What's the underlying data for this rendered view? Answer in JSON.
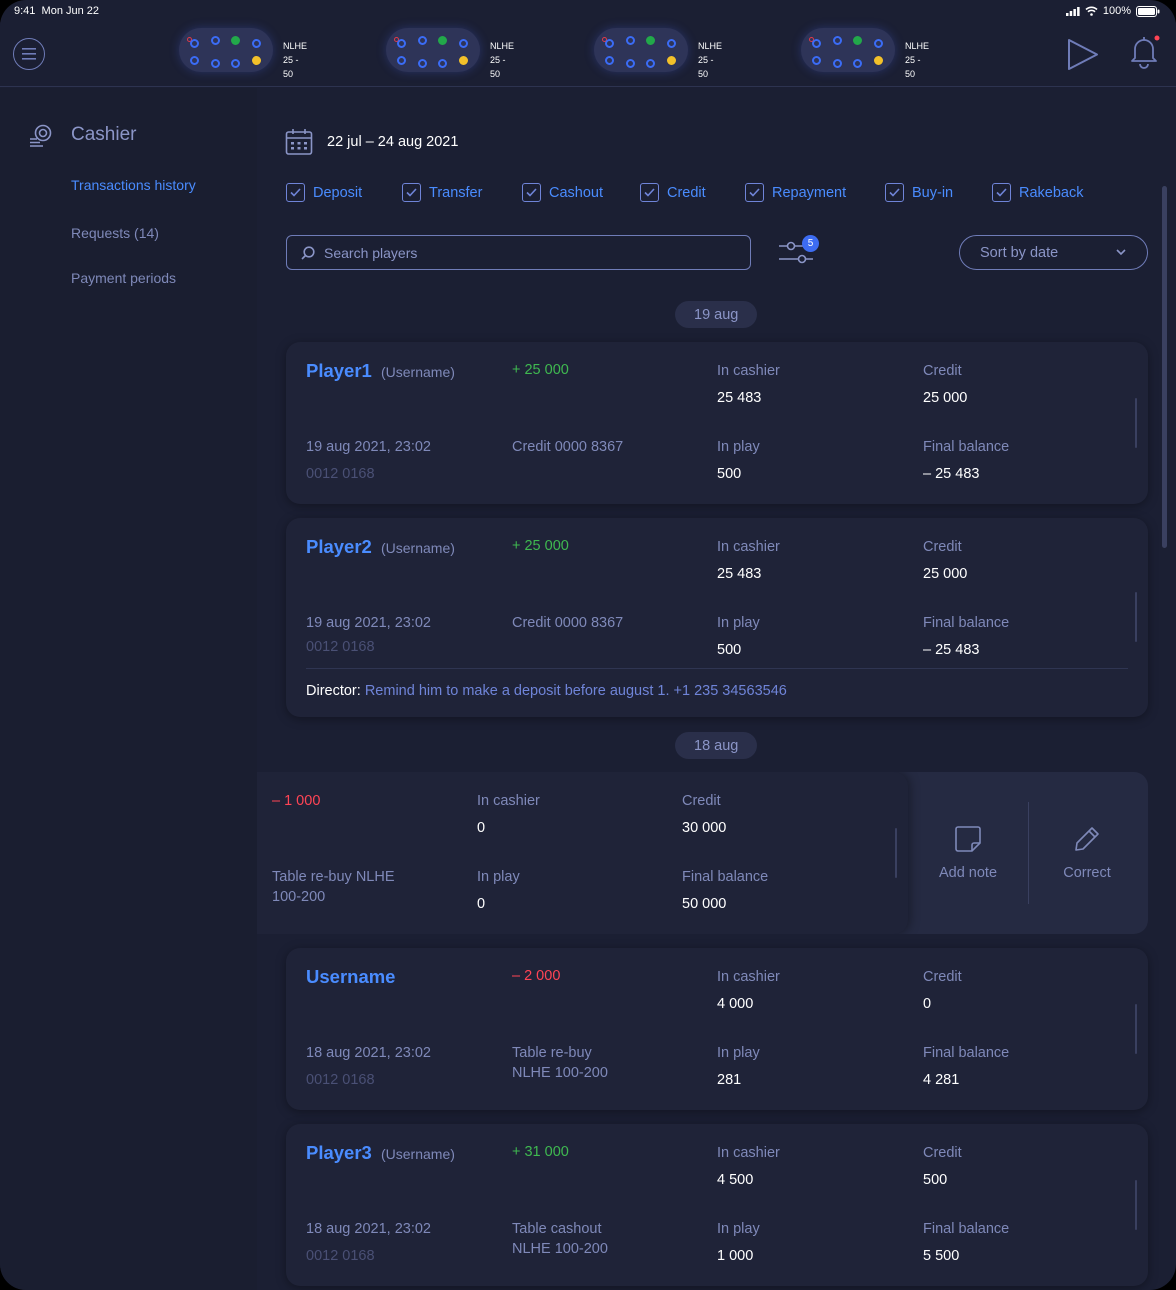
{
  "status": {
    "time": "9:41",
    "date": "Mon Jun 22",
    "battery": "100%"
  },
  "tables": [
    {
      "game": "NLHE",
      "stakes": "25 - 50"
    },
    {
      "game": "NLHE",
      "stakes": "25 - 50"
    },
    {
      "game": "NLHE",
      "stakes": "25 - 50"
    },
    {
      "game": "NLHE",
      "stakes": "25 - 50"
    }
  ],
  "sidebar": {
    "title": "Cashier",
    "items": [
      {
        "label": "Transactions history"
      },
      {
        "label": "Requests (14)"
      },
      {
        "label": "Payment periods"
      }
    ]
  },
  "date_range": "22 jul – 24 aug 2021",
  "filters": [
    {
      "label": "Deposit"
    },
    {
      "label": "Transfer"
    },
    {
      "label": "Cashout"
    },
    {
      "label": "Credit"
    },
    {
      "label": "Repayment"
    },
    {
      "label": "Buy-in"
    },
    {
      "label": "Rakeback"
    }
  ],
  "search": {
    "placeholder": "Search players"
  },
  "filter_badge": "5",
  "sort": {
    "label": "Sort by date"
  },
  "labels": {
    "in_cashier": "In cashier",
    "credit": "Credit",
    "in_play": "In play",
    "final_balance": "Final balance",
    "username_paren": "(Username)"
  },
  "groups": [
    {
      "date": "19 aug"
    },
    {
      "date": "18 aug"
    }
  ],
  "transactions": [
    {
      "name": "Player1",
      "amount": "+ 25 000",
      "datetime": "19 aug 2021, 23:02",
      "id": "0012 0168",
      "type": "Credit 0000 8367",
      "in_cashier": "25 483",
      "credit": "25 000",
      "in_play": "500",
      "final_balance": "– 25 483"
    },
    {
      "name": "Player2",
      "amount": "+ 25 000",
      "datetime": "19 aug 2021, 23:02",
      "id": "0012 0168",
      "type": "Credit 0000 8367",
      "in_cashier": "25 483",
      "credit": "25 000",
      "in_play": "500",
      "final_balance": "– 25 483",
      "note_author": "Director:",
      "note_text": "Remind him to make a deposit before august 1. +1 235 34563546"
    },
    {
      "amount": "– 1 000",
      "type_line1": "Table re-buy NLHE",
      "type_line2": "100-200",
      "in_cashier": "0",
      "credit": "30 000",
      "in_play": "0",
      "final_balance": "50 000"
    },
    {
      "name": "Username",
      "amount": "– 2 000",
      "datetime": "18 aug 2021, 23:02",
      "id": "0012 0168",
      "type_line1": "Table re-buy",
      "type_line2": "NLHE 100-200",
      "in_cashier": "4 000",
      "credit": "0",
      "in_play": "281",
      "final_balance": "4 281"
    },
    {
      "name": "Player3",
      "amount": "+ 31 000",
      "datetime": "18 aug 2021, 23:02",
      "id": "0012 0168",
      "type_line1": "Table cashout",
      "type_line2": "NLHE 100-200",
      "in_cashier": "4 500",
      "credit": "500",
      "in_play": "1 000",
      "final_balance": "5 500"
    }
  ],
  "actions": {
    "add_note": "Add note",
    "correct": "Correct"
  },
  "colors": {
    "accent": "#4a8cff",
    "positive": "#3fb950",
    "negative": "#ff4455",
    "background": "#1b1f33"
  }
}
